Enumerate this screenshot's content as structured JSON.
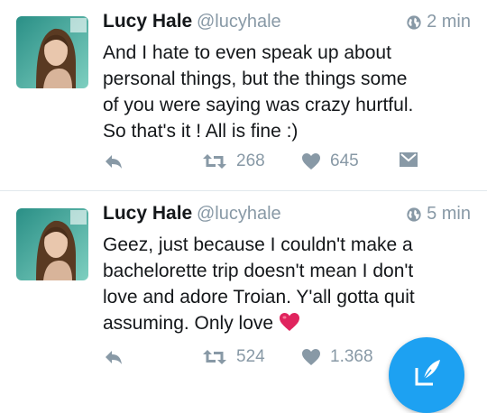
{
  "colors": {
    "accent": "#1da1f2",
    "muted": "#8899a6",
    "text": "#14171a",
    "heart": "#e0245e"
  },
  "tweets": [
    {
      "name": "Lucy Hale",
      "handle": "@lucyhale",
      "time": "2 min",
      "lines": [
        "And I hate to even speak up about",
        "personal things, but the things some",
        "of you were saying was crazy hurtful.",
        "So that's it ! All is fine :)"
      ],
      "retweets": "268",
      "likes": "645"
    },
    {
      "name": "Lucy Hale",
      "handle": "@lucyhale",
      "time": "5 min",
      "lines": [
        "Geez, just because I couldn't make a",
        "bachelorette trip doesn't mean I don't",
        "love and adore Troian. Y'all gotta quit",
        "assuming. Only love"
      ],
      "retweets": "524",
      "likes": "1.368"
    }
  ],
  "icons": [
    "globe-icon",
    "reply-icon",
    "retweet-icon",
    "heart-icon",
    "direct-message-icon",
    "red-heart-emoji-icon",
    "compose-tweet-icon"
  ]
}
